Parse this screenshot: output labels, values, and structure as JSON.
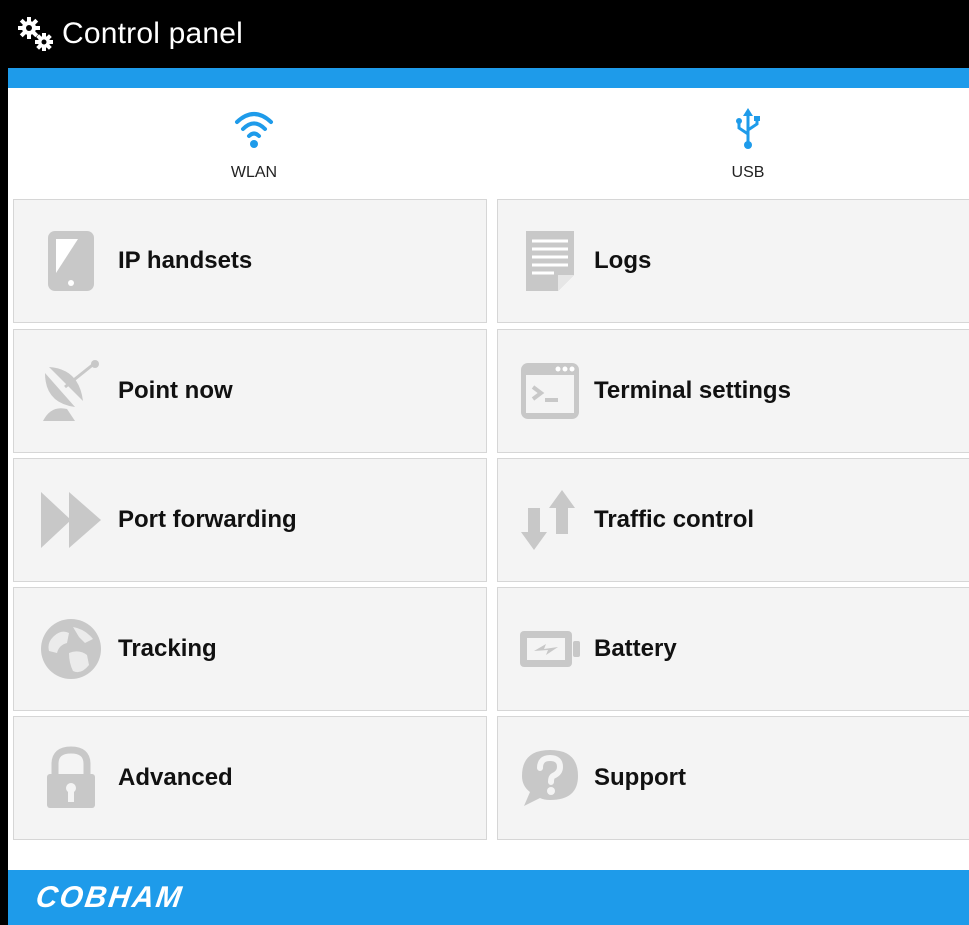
{
  "header": {
    "title": "Control panel",
    "icon": "gears-icon"
  },
  "quick_access": [
    {
      "label": "WLAN",
      "icon": "wifi-icon"
    },
    {
      "label": "USB",
      "icon": "usb-icon"
    }
  ],
  "tiles": [
    {
      "label": "IP handsets",
      "icon": "handset-icon"
    },
    {
      "label": "Logs",
      "icon": "log-document-icon"
    },
    {
      "label": "Point now",
      "icon": "satellite-dish-icon"
    },
    {
      "label": "Terminal settings",
      "icon": "terminal-window-icon"
    },
    {
      "label": "Port forwarding",
      "icon": "fast-forward-icon"
    },
    {
      "label": "Traffic control",
      "icon": "up-down-arrows-icon"
    },
    {
      "label": "Tracking",
      "icon": "globe-icon"
    },
    {
      "label": "Battery",
      "icon": "battery-icon"
    },
    {
      "label": "Advanced",
      "icon": "padlock-icon"
    },
    {
      "label": "Support",
      "icon": "question-bubble-icon"
    }
  ],
  "footer": {
    "brand": "COBHAM"
  },
  "colors": {
    "accent": "#1e9bea",
    "header_bg": "#000000",
    "tile_bg": "#f4f4f4",
    "icon_gray": "#c8c8c8"
  }
}
